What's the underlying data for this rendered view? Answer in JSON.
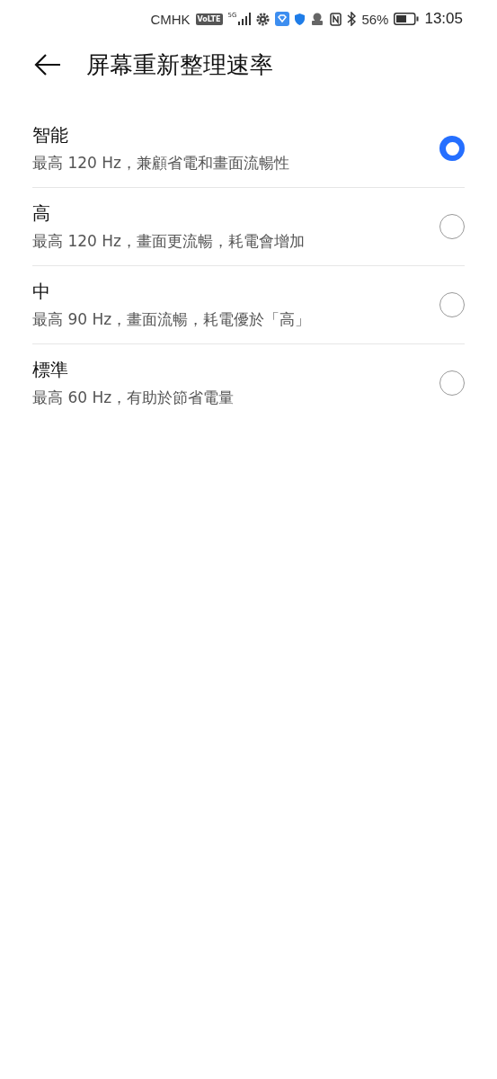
{
  "status_bar": {
    "carrier": "CMHK",
    "volte": "VoLTE",
    "network": "5G",
    "battery": "56%",
    "time": "13:05"
  },
  "header": {
    "title": "屏幕重新整理速率"
  },
  "options": [
    {
      "title": "智能",
      "subtitle": "最高 120 Hz，兼顧省電和畫面流暢性",
      "selected": true
    },
    {
      "title": "高",
      "subtitle": "最高 120 Hz，畫面更流暢，耗電會增加",
      "selected": false
    },
    {
      "title": "中",
      "subtitle": "最高 90 Hz，畫面流暢，耗電優於「高」",
      "selected": false
    },
    {
      "title": "標準",
      "subtitle": "最高 60 Hz，有助於節省電量",
      "selected": false
    }
  ]
}
